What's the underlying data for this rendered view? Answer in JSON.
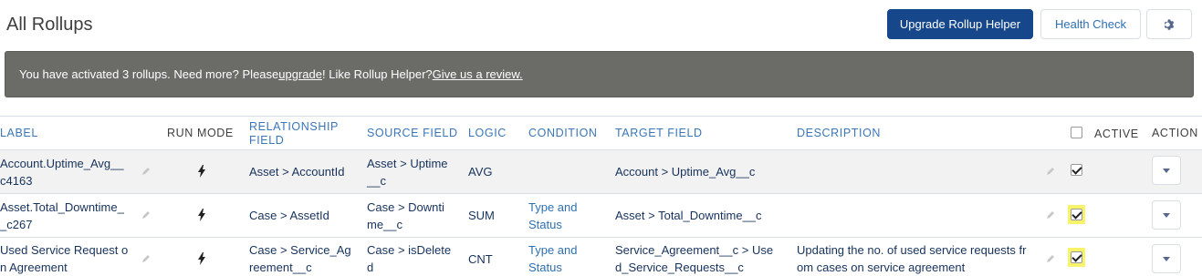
{
  "header": {
    "title": "All Rollups",
    "upgrade_button": "Upgrade Rollup Helper",
    "health_button": "Health Check",
    "settings_icon": "gear-icon"
  },
  "banner": {
    "text_before": "You have activated 3 rollups. Need more? Please ",
    "upgrade_link": "upgrade",
    "text_middle": "! Like Rollup Helper? ",
    "review_link": "Give us a review.",
    "background": "#6b6b67"
  },
  "columns": {
    "label": "LABEL",
    "run_mode": "RUN MODE",
    "relationship_field_1": "RELATIONSHIP",
    "relationship_field_2": "FIELD",
    "source_field": "SOURCE FIELD",
    "logic": "LOGIC",
    "condition": "CONDITION",
    "target_field": "TARGET FIELD",
    "description": "DESCRIPTION",
    "active": "ACTIVE",
    "action": "ACTION"
  },
  "rows": [
    {
      "label_1": "Account.Uptime_Avg__",
      "label_2": "c4163",
      "run_mode_icon": "lightning-icon",
      "relationship": "Asset > AccountId",
      "source_1": "Asset > Uptime",
      "source_2": "__c",
      "logic": "AVG",
      "condition_1": "",
      "condition_2": "",
      "target_1": "Account > Uptime_Avg__c",
      "target_2": "",
      "description_1": "",
      "description_2": "",
      "active": true,
      "highlighted": false
    },
    {
      "label_1": "Asset.Total_Downtime_",
      "label_2": "_c267",
      "run_mode_icon": "lightning-icon",
      "relationship": "Case > AssetId",
      "source_1": "Case > Downti",
      "source_2": "me__c",
      "logic": "SUM",
      "condition_1": "Type and",
      "condition_2": "Status",
      "target_1": "Asset > Total_Downtime__c",
      "target_2": "",
      "description_1": "",
      "description_2": "",
      "active": true,
      "highlighted": true
    },
    {
      "label_1": "Used Service Request o",
      "label_2": "n Agreement",
      "run_mode_icon": "lightning-icon",
      "relationship_1": "Case > Service_Ag",
      "relationship_2": "reement__c",
      "source_1": "Case > isDelete",
      "source_2": "d",
      "logic": "CNT",
      "condition_1": "Type and",
      "condition_2": "Status",
      "target_1": "Service_Agreement__c > Use",
      "target_2": "d_Service_Requests__c",
      "description_1": "Updating the no. of used service requests fr",
      "description_2": "om cases on service agreement",
      "active": true,
      "highlighted": true
    }
  ],
  "colors": {
    "primary": "#16478a",
    "link": "#2e6fb2",
    "highlight": "#f7f36a"
  }
}
